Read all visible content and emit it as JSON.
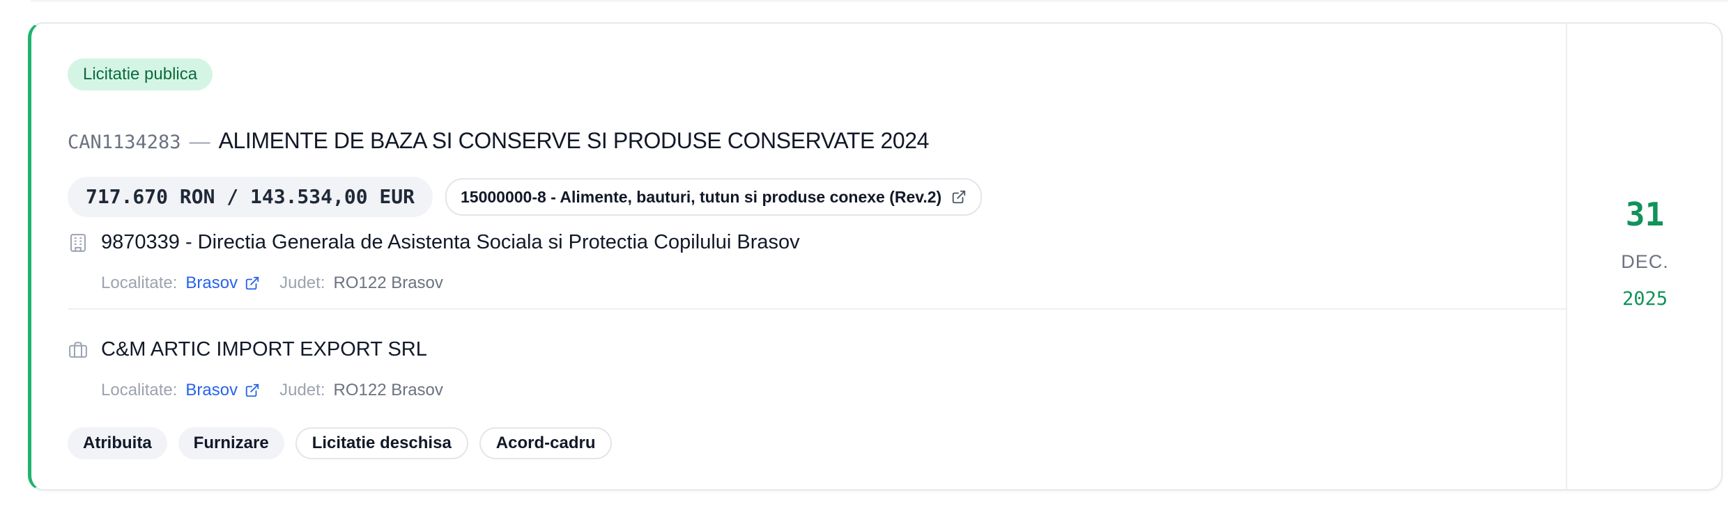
{
  "card": {
    "procedure_badge": "Licitatie publica",
    "notice_code": "CAN1134283",
    "separator": "—",
    "title": "ALIMENTE DE BAZA SI CONSERVE SI PRODUSE CONSERVATE 2024",
    "value": "717.670 RON / 143.534,00 EUR",
    "cpv": "15000000-8 - Alimente, bauturi, tutun si produse conexe (Rev.2)",
    "authority": {
      "icon": "building-icon",
      "name": "9870339 - Directia Generala de Asistenta Sociala si Protectia Copilului Brasov",
      "locality_label": "Localitate:",
      "locality": "Brasov",
      "county_label": "Judet:",
      "county": "RO122 Brasov"
    },
    "supplier": {
      "icon": "briefcase-icon",
      "name": "C&M ARTIC IMPORT EXPORT SRL",
      "locality_label": "Localitate:",
      "locality": "Brasov",
      "county_label": "Judet:",
      "county": "RO122 Brasov"
    },
    "tags": [
      "Atribuita",
      "Furnizare",
      "Licitatie deschisa",
      "Acord-cadru"
    ],
    "date": {
      "day": "31",
      "month": "DEC.",
      "year": "2025"
    },
    "colors": {
      "accent": "#1fb46e",
      "badge_bg": "#d5f5e4",
      "link": "#2563eb"
    }
  }
}
